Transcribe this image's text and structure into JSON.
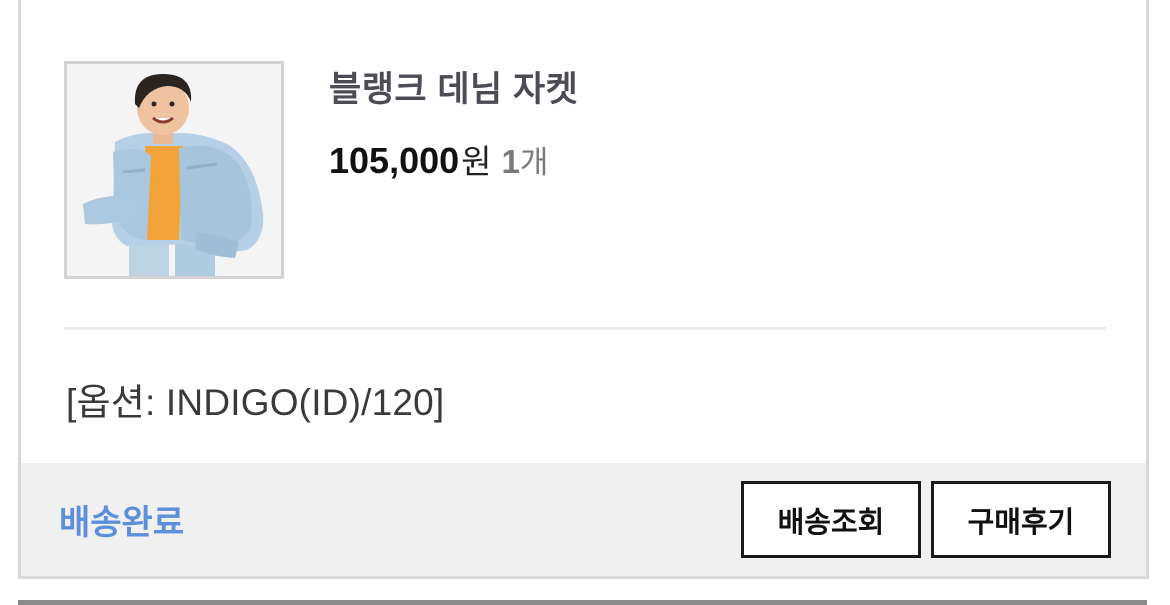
{
  "order_item": {
    "product_name": "블랭크 데님 자켓",
    "price": "105,000",
    "price_unit": "원",
    "quantity": "1",
    "quantity_unit": "개",
    "option": "[옵션: INDIGO(ID)/120]",
    "thumbnail_icon": "product-photo-kid-denim-jacket"
  },
  "footer": {
    "status": "배송완료",
    "track_button": "배송조회",
    "review_button": "구매후기"
  },
  "colors": {
    "status_blue": "#5b8fdb",
    "footer_bg": "#f0f0f0",
    "border": "#d9d9d9"
  }
}
